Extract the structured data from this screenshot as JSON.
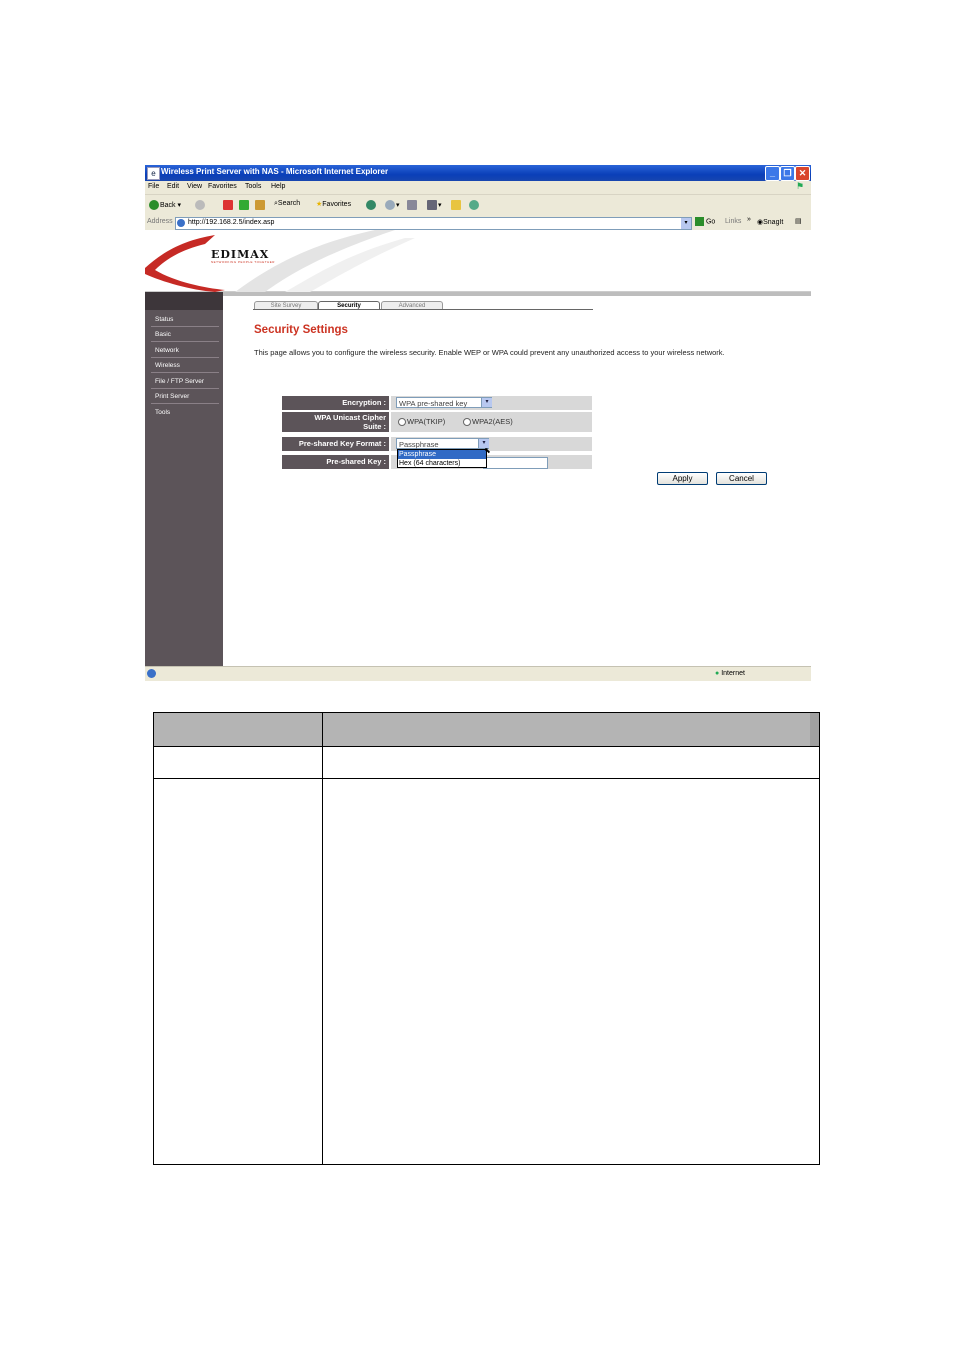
{
  "window": {
    "title": "Wireless Print Server with NAS - Microsoft Internet Explorer",
    "min_glyph": "_",
    "max_glyph": "❐",
    "close_glyph": "✕",
    "colors": {
      "titlebar": "#0a3fb8",
      "close": "#d9452c"
    }
  },
  "menu": [
    "File",
    "Edit",
    "View",
    "Favorites",
    "Tools",
    "Help"
  ],
  "toolbar": {
    "back": "Back",
    "search": "Search",
    "favorites": "Favorites"
  },
  "address": {
    "label": "Address",
    "url": "http://192.168.2.5/index.asp",
    "go": "Go",
    "links": "Links",
    "snagit": "SnagIt"
  },
  "brand": {
    "logo": "EDIMAX",
    "tagline": "NETWORKING PEOPLE TOGETHER",
    "color": "#c32"
  },
  "sidebar": {
    "items": [
      "Status",
      "Basic",
      "Network",
      "Wireless",
      "File / FTP Server",
      "Print Server",
      "Tools"
    ]
  },
  "tabs": [
    "Site Survey",
    "Security",
    "Advanced"
  ],
  "section": {
    "title": "Security Settings",
    "description": "This page allows you to configure the wireless security. Enable WEP or WPA could prevent any unauthorized access to your wireless network."
  },
  "form": {
    "encryption_label": "Encryption :",
    "encryption_value": "WPA pre-shared key",
    "cipher_label_1": "WPA Unicast Cipher",
    "cipher_label_2": "Suite :",
    "cipher_option_1": "WPA(TKIP)",
    "cipher_option_2": "WPA2(AES)",
    "key_format_label": "Pre-shared Key Format :",
    "key_format_value": "Passphrase",
    "key_format_options": [
      "Passphrase",
      "Hex (64 characters)"
    ],
    "key_label": "Pre-shared Key :",
    "apply": "Apply",
    "cancel": "Cancel"
  },
  "status": {
    "zone": "Internet"
  }
}
